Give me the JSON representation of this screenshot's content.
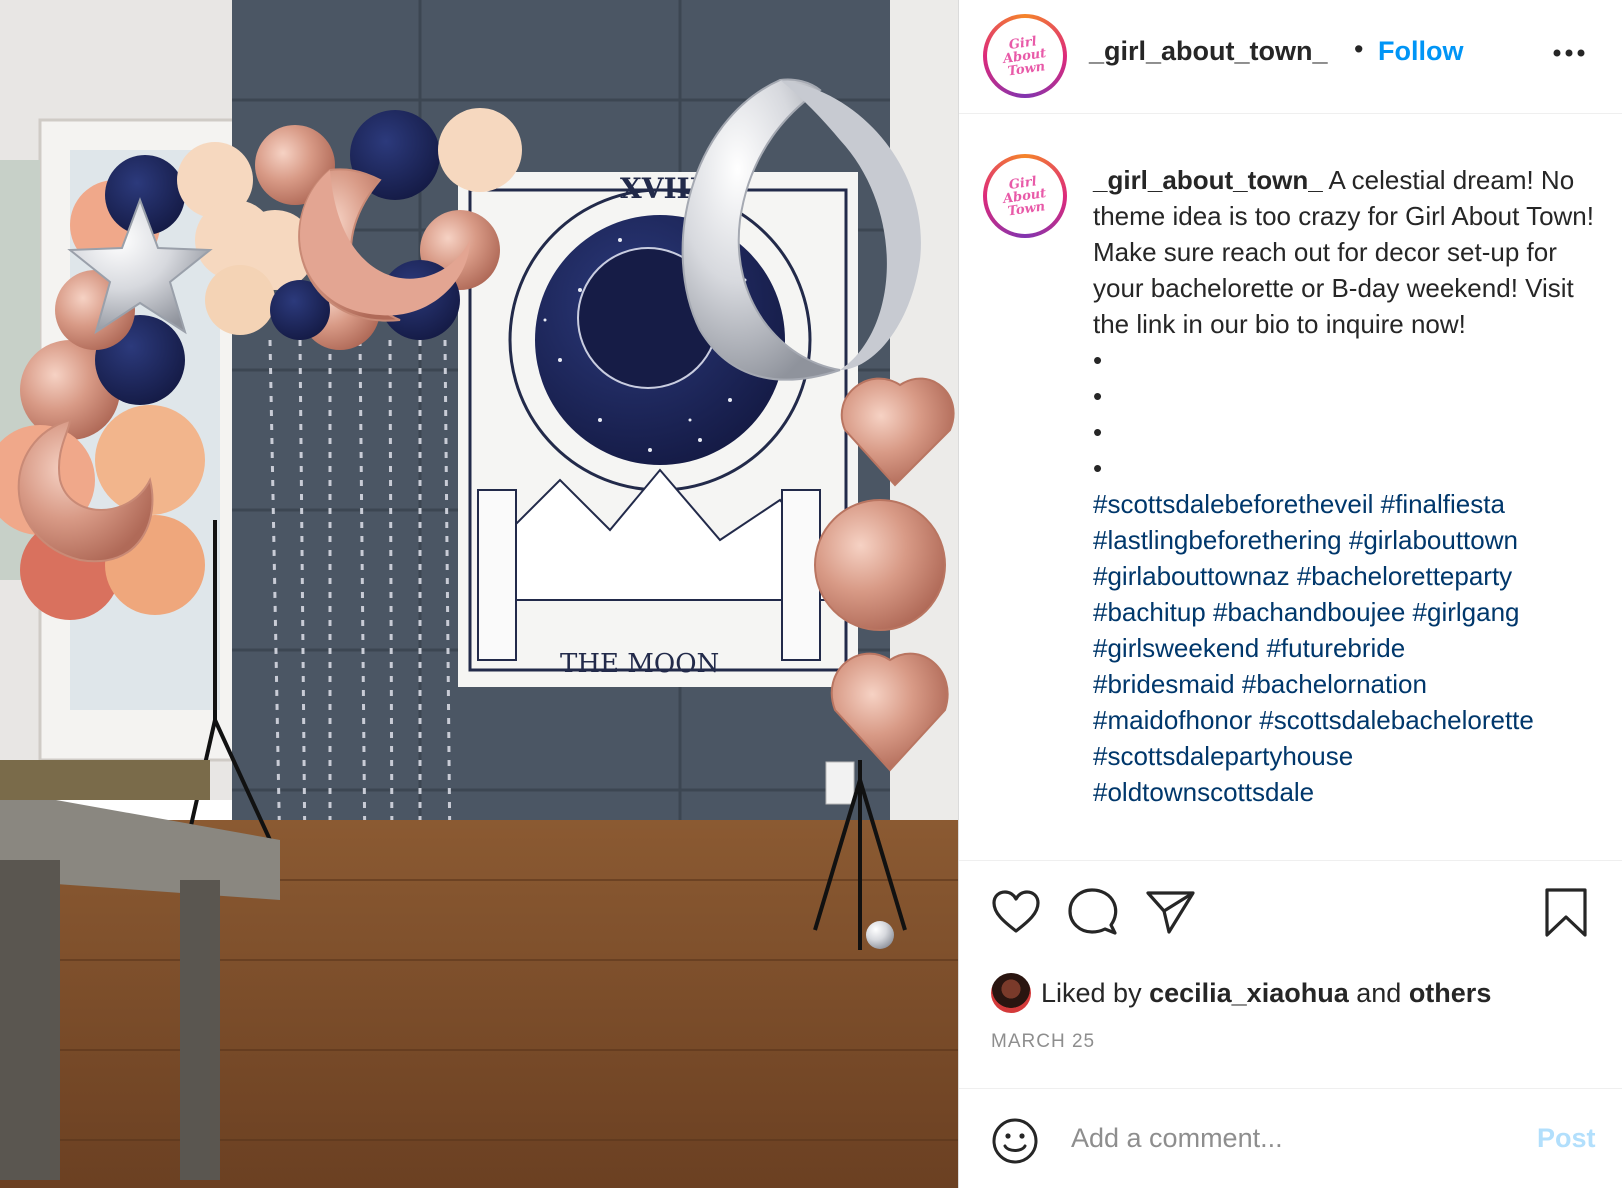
{
  "header": {
    "username": "_girl_about_town_",
    "separator": "•",
    "follow_label": "Follow",
    "avatar_logo_line1": "Girl",
    "avatar_logo_line2": "About",
    "avatar_logo_line3": "Town"
  },
  "photo": {
    "tapestry_number": "XVIII",
    "tapestry_title": "THE MOON"
  },
  "caption": {
    "username": "_girl_about_town_",
    "text": "A celestial dream! No theme idea is too crazy for Girl About Town! Make sure reach out for decor set-up for your bachelorette or B-day weekend! Visit the link in our bio to inquire now!",
    "bullets": [
      "•",
      "•",
      "•",
      "•"
    ],
    "hashtags": [
      "#scottsdalebeforetheveil",
      "#finalfiesta",
      "#lastlingbeforethering",
      "#girlabouttown",
      "#girlabouttownaz",
      "#bacheloretteparty",
      "#bachitup",
      "#bachandboujee",
      "#girlgang",
      "#girlsweekend",
      "#futurebride",
      "#bridesmaid",
      "#bachelornation",
      "#maidofhonor",
      "#scottsdalebachelorette",
      "#scottsdalepartyhouse",
      "#oldtownscottsdale"
    ]
  },
  "likes": {
    "prefix": "Liked by",
    "user": "cecilia_xiaohua",
    "conjunction": "and",
    "others": "others"
  },
  "date": "MARCH 25",
  "comment": {
    "placeholder": "Add a comment...",
    "post_label": "Post"
  },
  "icons": {
    "more": "more-options-icon",
    "like": "heart-icon",
    "comment": "comment-icon",
    "share": "paper-plane-icon",
    "save": "bookmark-icon",
    "emoji": "smiley-icon"
  },
  "colors": {
    "link_blue": "#0095f6",
    "hashtag_blue": "#00376b",
    "post_disabled": "#b2dffc",
    "meta_gray": "#8e8e8e"
  }
}
